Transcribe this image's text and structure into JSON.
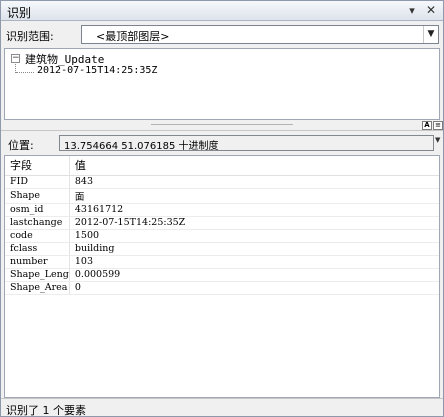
{
  "window": {
    "title": "识别"
  },
  "identify_from": {
    "label": "识别范围:",
    "value": "<最顶部图层>"
  },
  "tree": {
    "layer": "建筑物_Update",
    "feature": "2012-07-15T14:25:35Z"
  },
  "location": {
    "label": "位置:",
    "value": "13.754664   51.076185  十进制度"
  },
  "table": {
    "headers": [
      "字段",
      "值"
    ],
    "rows": [
      {
        "field": "FID",
        "value": "843"
      },
      {
        "field": "Shape",
        "value": "面"
      },
      {
        "field": "osm_id",
        "value": "43161712"
      },
      {
        "field": "lastchange",
        "value": "2012-07-15T14:25:35Z"
      },
      {
        "field": "code",
        "value": "1500"
      },
      {
        "field": "fclass",
        "value": "building"
      },
      {
        "field": "number",
        "value": "103"
      },
      {
        "field": "Shape_Leng",
        "value": "0.000599"
      },
      {
        "field": "Shape_Area",
        "value": "0"
      }
    ]
  },
  "status": {
    "text": "识别了 1 个要素"
  },
  "icons": {
    "pin": "pin-icon",
    "close": "close-icon",
    "dropdown": "chevron-down-icon",
    "collapse": "tree-collapse-icon"
  }
}
